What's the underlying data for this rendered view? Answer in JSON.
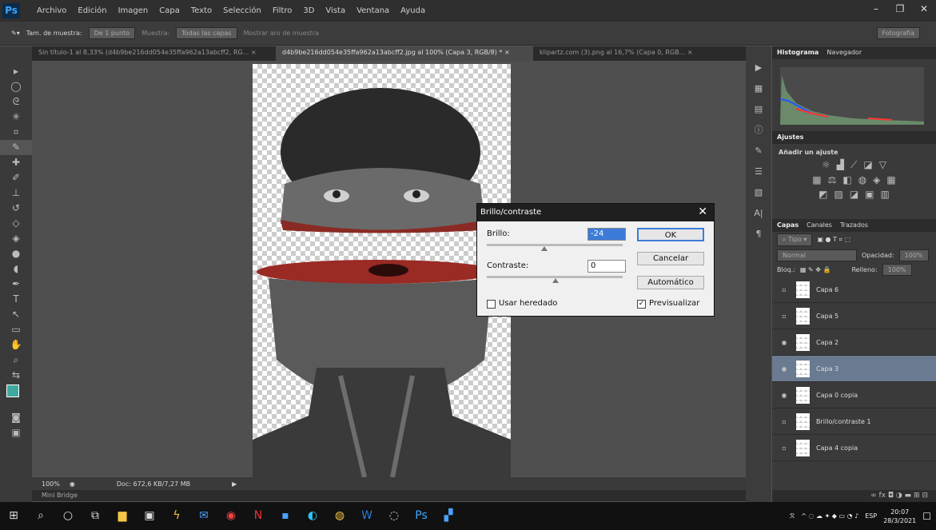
{
  "app": {
    "logo": "Ps"
  },
  "menu": [
    "Archivo",
    "Edición",
    "Imagen",
    "Capa",
    "Texto",
    "Selección",
    "Filtro",
    "3D",
    "Vista",
    "Ventana",
    "Ayuda"
  ],
  "options": {
    "sample_size_label": "Tam. de muestra:",
    "sample_size_value": "De 1 punto",
    "sample_label": "Muestra:",
    "sample_value": "Todas las capas",
    "show_ring": "Mostrar aro de muestra",
    "workspace": "Fotografía"
  },
  "tabs": [
    "Sin título-1 al 8,33% (d4b9be216dd054e35ffa962a13abcff2, RG...",
    "d4b9be216dd054e35ffa962a13abcff2.jpg al 100% (Capa 3, RGB/8) *",
    "klipartz.com (3).png al 16,7% (Capa 0, RGB..."
  ],
  "status": {
    "zoom": "100%",
    "doc": "Doc: 672,6 KB/7,27 MB"
  },
  "mini_bridge": "Mini Bridge",
  "panels": {
    "histogram_tabs": [
      "Histograma",
      "Navegador"
    ],
    "adjust_title": "Ajustes",
    "adjust_add": "Añadir un ajuste",
    "layer_tabs": [
      "Capas",
      "Canales",
      "Trazados"
    ],
    "kind": "Tipo",
    "blend_mode": "Normal",
    "opacity_label": "Opacidad:",
    "opacity": "100%",
    "lock_label": "Bloq.:",
    "fill_label": "Relleno:",
    "fill": "100%"
  },
  "layers": [
    {
      "name": "Capa 6",
      "visible": false,
      "selected": false
    },
    {
      "name": "Capa 5",
      "visible": false,
      "selected": false
    },
    {
      "name": "Capa 2",
      "visible": true,
      "selected": false
    },
    {
      "name": "Capa 3",
      "visible": true,
      "selected": true
    },
    {
      "name": "Capa 0 copia",
      "visible": true,
      "selected": false
    },
    {
      "name": "Brillo/contraste 1",
      "visible": false,
      "selected": false
    },
    {
      "name": "Capa 4 copia",
      "visible": false,
      "selected": false
    }
  ],
  "dialog": {
    "title": "Brillo/contraste",
    "brightness_label": "Brillo:",
    "brightness_value": "-24",
    "contrast_label": "Contraste:",
    "contrast_value": "0",
    "use_legacy": "Usar heredado",
    "preview": "Previsualizar",
    "ok": "OK",
    "cancel": "Cancelar",
    "auto": "Automático"
  },
  "taskbar": {
    "lang": "ESP",
    "time": "20:07",
    "date": "28/3/2021"
  }
}
